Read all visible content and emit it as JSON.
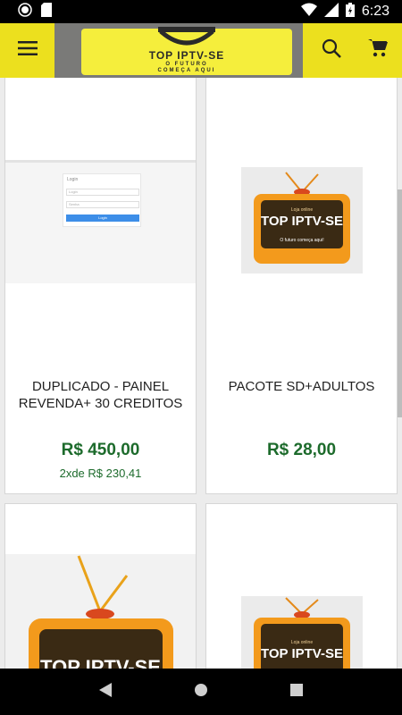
{
  "status_bar": {
    "time": "6:23"
  },
  "header": {
    "logo_title": "TOP IPTV-SE",
    "logo_tagline_1": "O FUTURO",
    "logo_tagline_2": "COMEÇA AQUI"
  },
  "products": [
    {
      "title": "DUPLICADO - PAINEL REVENDA+ 30 CREDITOS",
      "price": "R$ 450,00",
      "installment": "2xde R$ 230,41",
      "image": {
        "login_title": "Login",
        "field1_placeholder": "Login",
        "field2_placeholder": "Senha",
        "button_label": "Login"
      }
    },
    {
      "title": "PACOTE SD+ADULTOS",
      "price": "R$ 28,00",
      "image": {
        "caption_top": "Loja online",
        "brand": "TOP IPTV-SE",
        "caption_bottom": "O futuro começa aqui!"
      }
    },
    {
      "image": {
        "brand": "TOP IPTV-SE"
      }
    },
    {
      "image": {
        "caption_top": "Loja online",
        "brand": "TOP IPTV-SE"
      }
    }
  ],
  "colors": {
    "accent": "#ece01e",
    "price": "#1d6b2c"
  }
}
